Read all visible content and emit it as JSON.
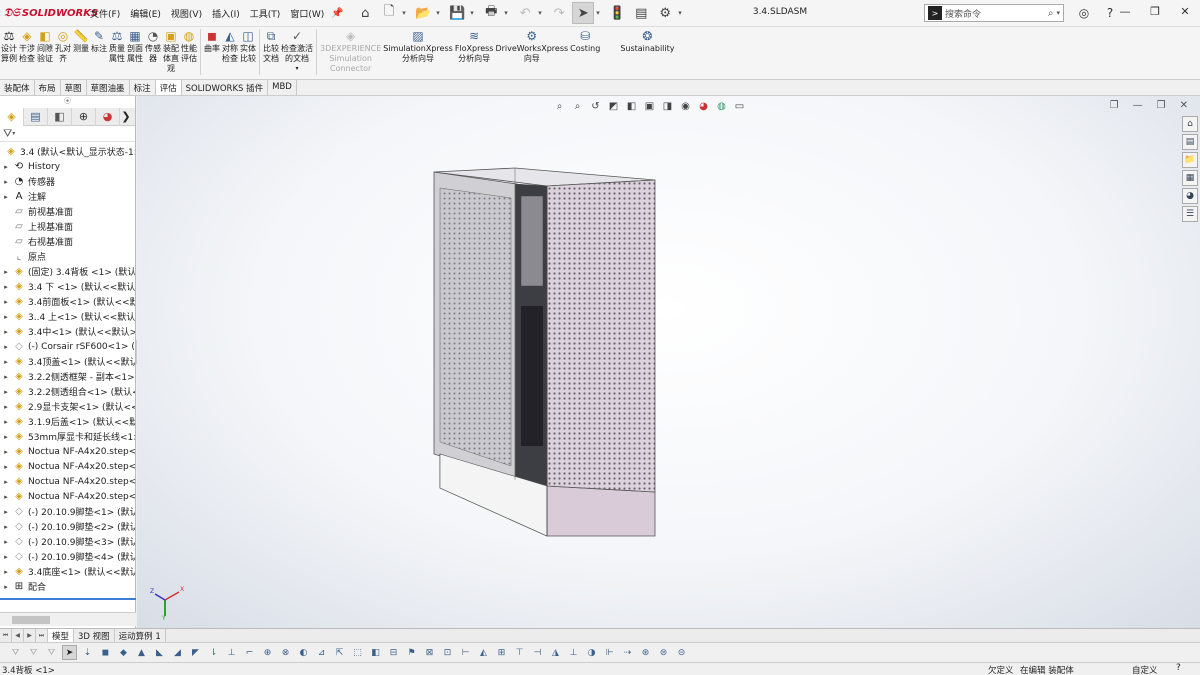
{
  "app": {
    "logo": "SOLIDWORKS",
    "document_title": "3.4.SLDASM",
    "menus": [
      "文件(F)",
      "编辑(E)",
      "视图(V)",
      "插入(I)",
      "工具(T)",
      "窗口(W)"
    ],
    "search_placeholder": "搜索命令"
  },
  "ribbon": {
    "buttons": [
      {
        "label": "设计\n算例",
        "icon": "design-study-icon"
      },
      {
        "label": "干涉\n检查",
        "icon": "interference-icon"
      },
      {
        "label": "间隙\n验证",
        "icon": "clearance-icon"
      },
      {
        "label": "孔对\n齐",
        "icon": "hole-align-icon"
      },
      {
        "label": "测量",
        "icon": "measure-icon"
      },
      {
        "label": "标注",
        "icon": "markup-icon"
      },
      {
        "label": "质量\n属性",
        "icon": "mass-properties-icon"
      },
      {
        "label": "剖面\n属性",
        "icon": "section-properties-icon"
      },
      {
        "label": "传感\n器",
        "icon": "sensor-icon"
      },
      {
        "label": "装配\n体直\n观",
        "icon": "assembly-visualization-icon"
      },
      {
        "label": "性能\n评估",
        "icon": "performance-icon"
      },
      {
        "label": "曲率",
        "icon": "curvature-icon"
      },
      {
        "label": "对称\n检查",
        "icon": "symmetry-icon"
      },
      {
        "label": "实体\n比较",
        "icon": "body-compare-icon"
      },
      {
        "label": "比较\n文档",
        "icon": "compare-docs-icon"
      },
      {
        "label": "检查激活\n的文档",
        "icon": "check-active-icon"
      }
    ],
    "addins": [
      {
        "label": "3DEXPERIENCE\nSimulation\nConnector",
        "dim": true
      },
      {
        "label": "SimulationXpress\n分析向导",
        "dim": false
      },
      {
        "label": "FloXpress\n分析向导",
        "dim": false
      },
      {
        "label": "DriveWorksXpress\n向导",
        "dim": false
      },
      {
        "label": "Costing",
        "dim": false
      },
      {
        "label": "Sustainability",
        "dim": false
      }
    ]
  },
  "tabs": [
    "装配体",
    "布局",
    "草图",
    "草图油墨",
    "标注",
    "评估",
    "SOLIDWORKS 插件",
    "MBD"
  ],
  "active_tab": "评估",
  "tree": {
    "root": "3.4  (默认<默认_显示状态-1>)",
    "items": [
      {
        "label": "History",
        "icon": "history-icon",
        "type": "folder"
      },
      {
        "label": "传感器",
        "icon": "sensor-icon",
        "type": "folder"
      },
      {
        "label": "注解",
        "icon": "annotation-icon",
        "type": "folder"
      },
      {
        "label": "前视基准面",
        "icon": "plane-icon",
        "type": "plane"
      },
      {
        "label": "上视基准面",
        "icon": "plane-icon",
        "type": "plane"
      },
      {
        "label": "右视基准面",
        "icon": "plane-icon",
        "type": "plane"
      },
      {
        "label": "原点",
        "icon": "origin-icon",
        "type": "plane"
      },
      {
        "label": "(固定) 3.4背板 <1> (默认<",
        "icon": "assembly-icon",
        "type": "asm"
      },
      {
        "label": "3.4 下 <1> (默认<<默认>",
        "icon": "assembly-icon",
        "type": "asm"
      },
      {
        "label": "3.4前面板<1> (默认<<默认",
        "icon": "assembly-icon",
        "type": "asm"
      },
      {
        "label": "3..4 上<1> (默认<<默认>",
        "icon": "assembly-icon",
        "type": "asm"
      },
      {
        "label": "3.4中<1> (默认<<默认>_",
        "icon": "assembly-icon",
        "type": "asm"
      },
      {
        "label": "(-) Corsair rSF600<1> (",
        "icon": "part-icon",
        "type": "part"
      },
      {
        "label": "3.4顶盖<1> (默认<<默认:",
        "icon": "assembly-icon",
        "type": "asm"
      },
      {
        "label": "3.2.2侧透框架 - 副本<1> (",
        "icon": "assembly-icon",
        "type": "asm"
      },
      {
        "label": "3.2.2侧透组合<1> (默认<",
        "icon": "assembly-icon",
        "type": "asm"
      },
      {
        "label": "2.9显卡支架<1> (默认<<",
        "icon": "assembly-icon",
        "type": "asm"
      },
      {
        "label": "3.1.9后盖<1> (默认<<默认",
        "icon": "assembly-icon",
        "type": "asm"
      },
      {
        "label": "53mm厚显卡和延长线<1>",
        "icon": "assembly-icon",
        "type": "asm"
      },
      {
        "label": "Noctua NF-A4x20.step<",
        "icon": "assembly-icon",
        "type": "asm"
      },
      {
        "label": "Noctua NF-A4x20.step<2",
        "icon": "assembly-icon",
        "type": "asm"
      },
      {
        "label": "Noctua NF-A4x20.step<",
        "icon": "assembly-icon",
        "type": "asm"
      },
      {
        "label": "Noctua NF-A4x20.step<",
        "icon": "assembly-icon",
        "type": "asm"
      },
      {
        "label": "(-) 20.10.9脚垫<1> (默认",
        "icon": "part-icon",
        "type": "part"
      },
      {
        "label": "(-) 20.10.9脚垫<2> (默认",
        "icon": "part-icon",
        "type": "part"
      },
      {
        "label": "(-) 20.10.9脚垫<3> (默认",
        "icon": "part-icon",
        "type": "part"
      },
      {
        "label": "(-) 20.10.9脚垫<4> (默认",
        "icon": "part-icon",
        "type": "part"
      },
      {
        "label": "3.4底座<1> (默认<<默认:",
        "icon": "assembly-icon",
        "type": "asm"
      },
      {
        "label": "配合",
        "icon": "mates-icon",
        "type": "folder"
      }
    ]
  },
  "bottom_tabs": [
    "模型",
    "3D 视图",
    "运动算例 1"
  ],
  "active_bottom_tab": "模型",
  "triad": {
    "x": "X",
    "y": "Y",
    "z": "Z"
  },
  "status": {
    "selection": "3.4背板 <1>",
    "state1": "欠定义",
    "state2": "在编辑 装配体",
    "units": "自定义",
    "help": "?"
  },
  "colors": {
    "accent": "#3b7dd8",
    "brand": "#c8102e",
    "model_frame": "#c9c9cf",
    "model_panel": "#d9ccd8",
    "model_base": "#f4f4f4"
  }
}
